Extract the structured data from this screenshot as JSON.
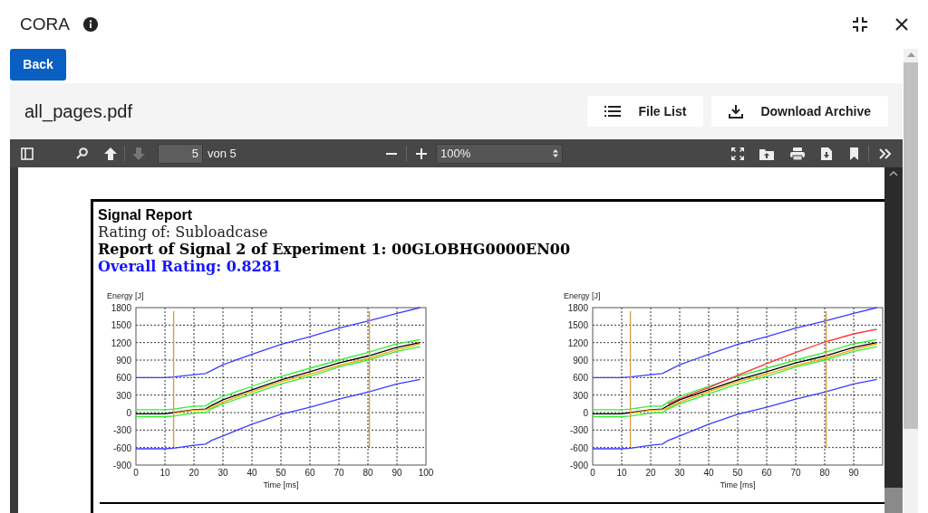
{
  "app": {
    "title": "CORA"
  },
  "back_button": "Back",
  "file": {
    "name": "all_pages.pdf",
    "buttons": [
      {
        "label": "File List",
        "kind": "list"
      },
      {
        "label": "Download Archive",
        "kind": "download"
      }
    ]
  },
  "viewer": {
    "nav": [
      {
        "kind": "previous",
        "disabled": false
      },
      {
        "kind": "next",
        "disabled": true
      }
    ],
    "page_number": "5",
    "page_count": "von 5",
    "zoom": "100%"
  },
  "report": {
    "title": "Signal Report",
    "rating_of": "Rating of: Subloadcase",
    "heading": "Report of Signal 2 of Experiment 1: 00GLOBHG0000EN00",
    "overall": "Overall Rating: 0.8281",
    "charts": [
      {
        "chart_data": {
          "type": "line",
          "grid": true,
          "xlabel": "Time [ms]",
          "ylabel": "Energy [J]",
          "x": [
            0,
            10,
            13,
            20,
            24,
            26,
            30,
            40,
            50,
            60,
            70,
            80,
            90,
            98
          ],
          "xlim": [
            0,
            100
          ],
          "ylim": [
            -900,
            1800
          ],
          "xticks": [
            0,
            10,
            20,
            30,
            40,
            50,
            60,
            70,
            80,
            90,
            100
          ],
          "yticks": [
            -900,
            -600,
            -300,
            0,
            300,
            600,
            900,
            1200,
            1500,
            1800
          ],
          "series": [
            {
              "color": "#3c3cff",
              "values": [
                600,
                600,
                610,
                650,
                670,
                720,
                820,
                1000,
                1170,
                1300,
                1450,
                1570,
                1700,
                1800
              ]
            },
            {
              "color": "#33ee33",
              "values": [
                50,
                50,
                60,
                110,
                110,
                180,
                280,
                450,
                620,
                760,
                900,
                1030,
                1180,
                1250
              ]
            },
            {
              "color": "#000000",
              "values": [
                -20,
                -20,
                0,
                50,
                60,
                120,
                220,
                390,
                560,
                700,
                850,
                970,
                1120,
                1200
              ]
            },
            {
              "color": "#ffa500",
              "values": [
                null,
                null,
                -10,
                40,
                50,
                80,
                180,
                360,
                530,
                660,
                810,
                930,
                1080,
                1180
              ]
            },
            {
              "color": "#33ee33",
              "values": [
                -70,
                -70,
                -60,
                -10,
                0,
                60,
                150,
                320,
                490,
                620,
                780,
                900,
                1050,
                1130
              ]
            },
            {
              "color": "#3c3cff",
              "values": [
                -620,
                -620,
                -610,
                -560,
                -540,
                -480,
                -400,
                -200,
                -30,
                90,
                230,
                350,
                490,
                570
              ]
            }
          ],
          "ref_lines": [
            {
              "axis": "x",
              "value": 13,
              "color": "#d4a04a"
            },
            {
              "axis": "x",
              "value": 80.5,
              "color": "#d4a04a"
            }
          ]
        }
      },
      {
        "chart_data": {
          "type": "line",
          "grid": true,
          "xlabel": "Time [ms]",
          "ylabel": "Energy [J]",
          "x": [
            0,
            10,
            13,
            20,
            24,
            26,
            30,
            40,
            50,
            60,
            70,
            80,
            90,
            98
          ],
          "xlim": [
            0,
            100
          ],
          "ylim": [
            -900,
            1800
          ],
          "xticks": [
            0,
            10,
            20,
            30,
            40,
            50,
            60,
            70,
            80,
            90
          ],
          "yticks": [
            -900,
            -600,
            -300,
            0,
            300,
            600,
            900,
            1200,
            1500,
            1800
          ],
          "series": [
            {
              "color": "#3c3cff",
              "values": [
                600,
                600,
                610,
                650,
                670,
                720,
                820,
                1000,
                1170,
                1300,
                1450,
                1570,
                1700,
                1800
              ]
            },
            {
              "color": "#33ee33",
              "values": [
                50,
                50,
                60,
                110,
                110,
                180,
                280,
                450,
                620,
                760,
                900,
                1030,
                1180,
                1250
              ]
            },
            {
              "color": "#000000",
              "values": [
                -20,
                -20,
                0,
                50,
                60,
                120,
                220,
                390,
                560,
                700,
                850,
                970,
                1120,
                1200
              ]
            },
            {
              "color": "#ffa500",
              "values": [
                null,
                null,
                -10,
                40,
                50,
                80,
                180,
                360,
                530,
                660,
                810,
                930,
                1080,
                1180
              ]
            },
            {
              "color": "#33ee33",
              "values": [
                -70,
                -70,
                -60,
                -10,
                0,
                60,
                150,
                320,
                490,
                620,
                780,
                900,
                1050,
                1130
              ]
            },
            {
              "color": "#3c3cff",
              "values": [
                -620,
                -620,
                -610,
                -560,
                -540,
                -480,
                -400,
                -200,
                -30,
                90,
                230,
                350,
                490,
                570
              ]
            },
            {
              "color": "#ff3030",
              "values": [
                null,
                null,
                null,
                null,
                null,
                150,
                240,
                430,
                640,
                840,
                1030,
                1210,
                1350,
                1430
              ]
            }
          ],
          "ref_lines": [
            {
              "axis": "x",
              "value": 13,
              "color": "#d4a04a"
            },
            {
              "axis": "x",
              "value": 80.5,
              "color": "#d4a04a"
            }
          ]
        }
      }
    ]
  }
}
